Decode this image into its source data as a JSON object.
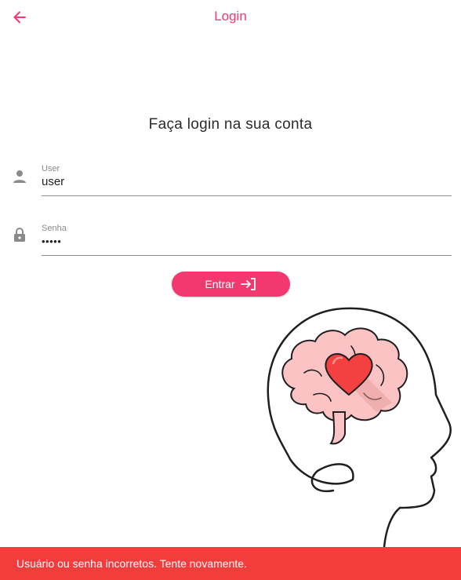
{
  "appbar": {
    "title": "Login",
    "back_icon": "arrow-back-icon",
    "accent": "#f2386f"
  },
  "heading": "Faça login na sua conta",
  "form": {
    "user": {
      "label": "User",
      "value": "user",
      "icon": "person-icon"
    },
    "password": {
      "label": "Senha",
      "value": "•••••",
      "icon": "lock-icon"
    },
    "submit": {
      "label": "Entrar",
      "icon": "login-icon"
    }
  },
  "illustration": {
    "icon": "brain-heart-illustration"
  },
  "snackbar": {
    "message": "Usuário ou senha incorretos. Tente novamente.",
    "color": "#f33c3c"
  }
}
